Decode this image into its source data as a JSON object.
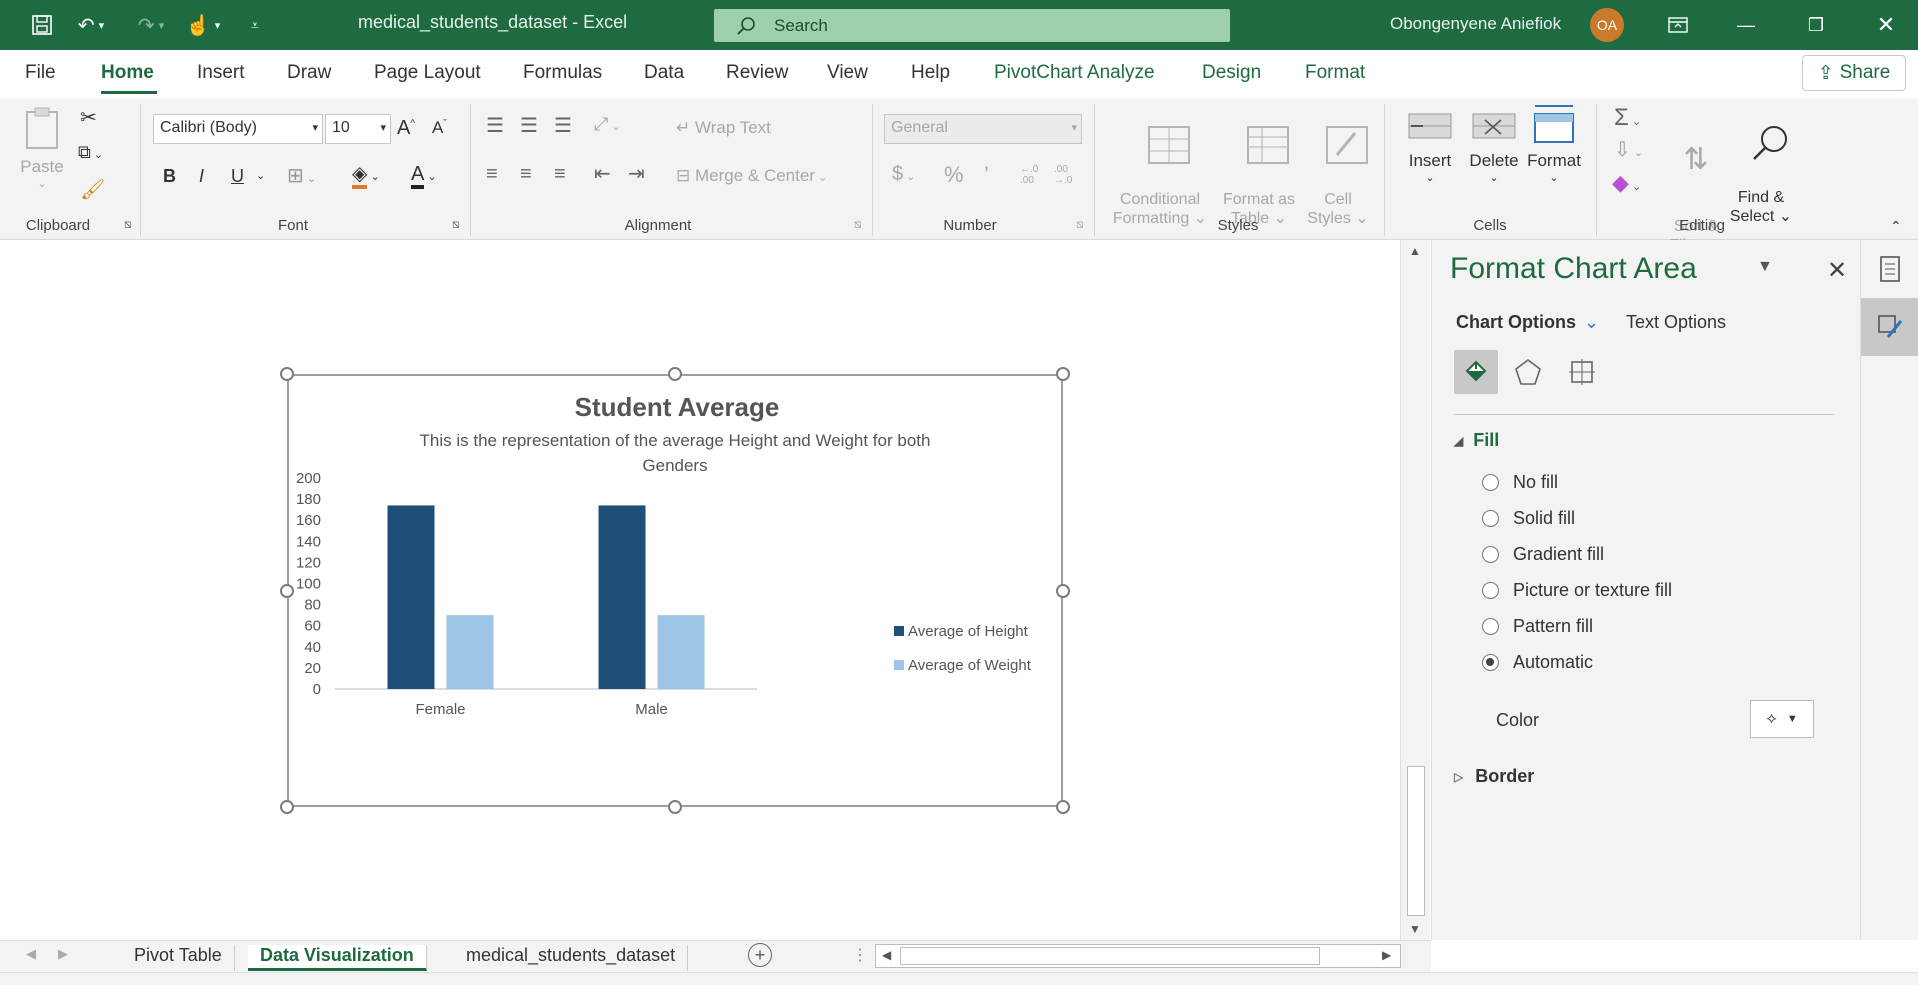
{
  "titlebar": {
    "document_title": "medical_students_dataset  -  Excel",
    "search_placeholder": "Search",
    "user_name": "Obongenyene Aniefiok",
    "user_initials": "OA"
  },
  "tabs": [
    "File",
    "Home",
    "Insert",
    "Draw",
    "Page Layout",
    "Formulas",
    "Data",
    "Review",
    "View",
    "Help",
    "PivotChart Analyze",
    "Design",
    "Format"
  ],
  "active_tab": "Home",
  "share_label": "Share",
  "ribbon": {
    "clipboard": {
      "paste_label": "Paste",
      "group_label": "Clipboard"
    },
    "font": {
      "font_name": "Calibri (Body)",
      "font_size": "10",
      "bold": "B",
      "italic": "I",
      "underline": "U",
      "font_color": "A",
      "group_label": "Font"
    },
    "alignment": {
      "wrap_text": "Wrap Text",
      "merge_center": "Merge & Center",
      "group_label": "Alignment"
    },
    "number": {
      "format": "General",
      "currency": "$",
      "percent": "%",
      "comma": "’",
      "inc_decimal": "←.0\n.00",
      "dec_decimal": ".00\n→.0",
      "group_label": "Number"
    },
    "styles": {
      "conditional_formatting": "Conditional\nFormatting ⌄",
      "format_as_table": "Format as\nTable ⌄",
      "cell_styles": "Cell\nStyles ⌄",
      "group_label": "Styles"
    },
    "cells": {
      "insert": "Insert",
      "delete": "Delete",
      "format": "Format",
      "group_label": "Cells"
    },
    "editing": {
      "sort_filter": "Sort &\nFilter ⌄",
      "find_select": "Find &\nSelect ⌄",
      "group_label": "Editing"
    }
  },
  "chart_data": {
    "type": "bar",
    "title": "Student Average",
    "subtitle": "This is the representation of the average Height and Weight for both Genders",
    "categories": [
      "Female",
      "Male"
    ],
    "series": [
      {
        "name": "Average of Height",
        "values": [
          174,
          174
        ],
        "color": "#1f4e79"
      },
      {
        "name": "Average of Weight",
        "values": [
          70,
          70
        ],
        "color": "#9dc3e6"
      }
    ],
    "ylim": [
      0,
      200
    ],
    "yticks": [
      0,
      20,
      40,
      60,
      80,
      100,
      120,
      140,
      160,
      180,
      200
    ],
    "legend_position": "right",
    "grid": false
  },
  "format_pane": {
    "title": "Format Chart Area",
    "tab_chart_options": "Chart Options",
    "tab_text_options": "Text Options",
    "fill_section": "Fill",
    "fill_options": [
      "No fill",
      "Solid fill",
      "Gradient fill",
      "Picture or texture fill",
      "Pattern fill",
      "Automatic"
    ],
    "selected_fill": "Automatic",
    "color_label": "Color",
    "border_section": "Border"
  },
  "sheet_tabs": [
    "Pivot Table",
    "Data Visualization",
    "medical_students_dataset"
  ],
  "active_sheet": "Data Visualization"
}
